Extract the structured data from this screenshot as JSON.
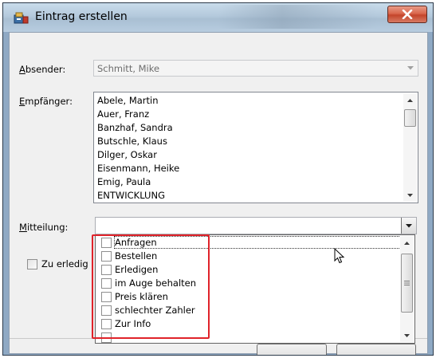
{
  "window": {
    "title": "Eintrag erstellen",
    "close_icon": "close-x-icon"
  },
  "form": {
    "sender": {
      "label_underlined": "A",
      "label_rest": "bsender:",
      "value": "Schmitt, Mike"
    },
    "recipients": {
      "label_underlined": "E",
      "label_rest": "mpfänger:",
      "items": [
        "Abele, Martin",
        "Auer, Franz",
        "Banzhaf, Sandra",
        "Butschle, Klaus",
        "Dilger, Oskar",
        "Eisenmann, Heike",
        "Emig, Paula",
        "ENTWICKLUNG"
      ]
    },
    "message": {
      "label_underlined": "M",
      "label_rest": "itteilung:",
      "value": ""
    },
    "todo": {
      "label": "Zu erledig"
    }
  },
  "dropdown": {
    "options": [
      "Anfragen",
      "Bestellen",
      "Erledigen",
      "im Auge behalten",
      "Preis klären",
      "schlechter Zahler",
      "Zur Info"
    ]
  },
  "colors": {
    "highlight_frame": "#e0232a",
    "close_button": "#c4452b"
  }
}
